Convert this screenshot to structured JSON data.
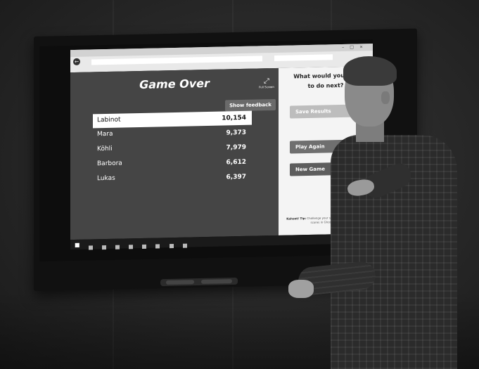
{
  "game": {
    "title": "Game Over",
    "fullscreen_label": "Full Screen",
    "feedback_button": "Show feedback",
    "leaderboard": [
      {
        "name": "Labinot",
        "score": "10,154"
      },
      {
        "name": "Mara",
        "score": "9,373"
      },
      {
        "name": "Köhli",
        "score": "7,979"
      },
      {
        "name": "Barbora",
        "score": "6,612"
      },
      {
        "name": "Lukas",
        "score": "6,397"
      }
    ]
  },
  "side_panel": {
    "title_line1": "What would you like",
    "title_line2": "to do next?",
    "save_button": "Save Results",
    "play_again_button": "Play Again",
    "new_game_button": "New Game",
    "tip_label": "Kahoot! Tip:",
    "tip_text": "Challenge your students to beat their old scores in Ghost Mode"
  },
  "colors": {
    "game_background": "#454545",
    "side_background": "#f4f4f4",
    "highlight_row": "#ffffff"
  }
}
